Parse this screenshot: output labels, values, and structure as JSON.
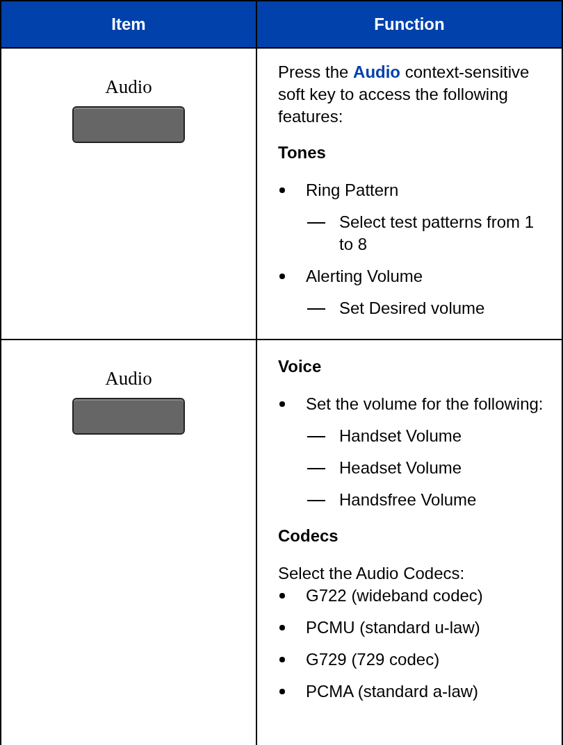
{
  "table": {
    "columns": [
      "Item",
      "Function"
    ],
    "rows": [
      {
        "item": "Audio",
        "function": [
          {
            "kind": "paragraph",
            "text": "Press the **Audio** context-sensitive soft key to access the following features:"
          },
          {
            "kind": "heading",
            "text": "Tones"
          },
          {
            "kind": "bullet",
            "text": "Ring Pattern"
          },
          {
            "kind": "dash",
            "text": "Select test patterns from 1 to 8"
          },
          {
            "kind": "bullet",
            "text": "Alerting Volume"
          },
          {
            "kind": "dash",
            "text": "Set Desired volume"
          }
        ]
      },
      {
        "item": "Audio",
        "function": [
          {
            "kind": "heading",
            "text": "Voice"
          },
          {
            "kind": "bullet",
            "text": "Set the volume for the following:"
          },
          {
            "kind": "dash",
            "text": "Handset Volume"
          },
          {
            "kind": "dash",
            "text": "Headset Volume"
          },
          {
            "kind": "dash",
            "text": "Handsfree Volume"
          },
          {
            "kind": "heading",
            "text": "Codecs"
          },
          {
            "kind": "lead",
            "text": "Select the Audio Codecs:"
          },
          {
            "kind": "bullet",
            "text": "G722 (wideband codec)"
          },
          {
            "kind": "bullet",
            "text": "PCMU (standard u-law)"
          },
          {
            "kind": "bullet",
            "text": "G729 (729 codec)"
          },
          {
            "kind": "bullet",
            "text": "PCMA (standard a-law)"
          }
        ]
      }
    ]
  }
}
